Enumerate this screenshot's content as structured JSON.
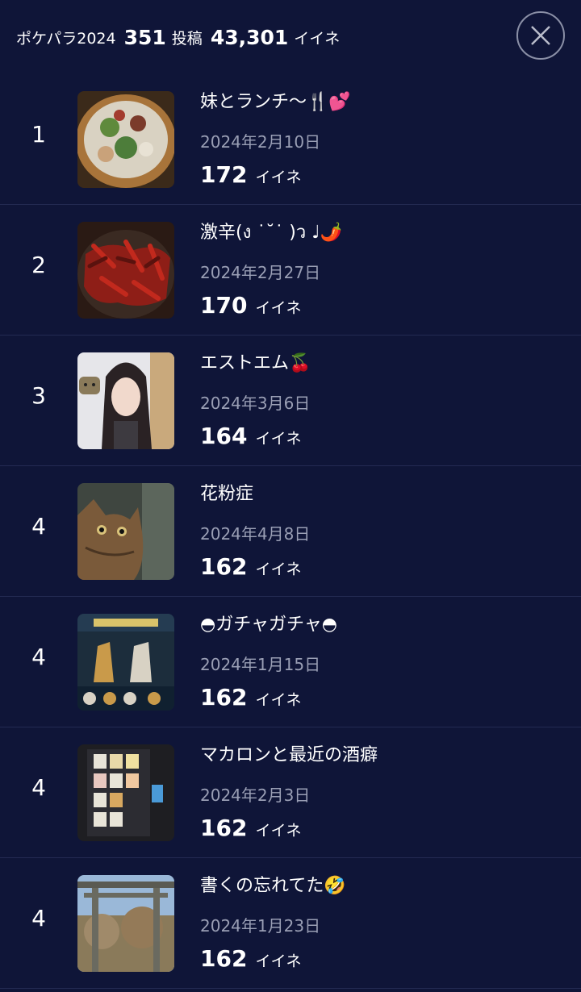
{
  "header": {
    "app_name": "ポケパラ2024",
    "post_count": "351",
    "post_unit": "投稿",
    "like_count": "43,301",
    "like_unit": "イイネ"
  },
  "posts": [
    {
      "rank": "1",
      "title": "妹とランチ〜🍴💕",
      "date": "2024年2月10日",
      "likes": "172",
      "likes_unit": "イイネ",
      "image": "salad-bowl"
    },
    {
      "rank": "2",
      "title": "激辛(ง ˙˘˙ )ว ♩🌶️",
      "date": "2024年2月27日",
      "likes": "170",
      "likes_unit": "イイネ",
      "image": "chili-dish"
    },
    {
      "rank": "3",
      "title": "エストエム🍒",
      "date": "2024年3月6日",
      "likes": "164",
      "likes_unit": "イイネ",
      "image": "portrait"
    },
    {
      "rank": "4",
      "title": "花粉症",
      "date": "2024年4月8日",
      "likes": "162",
      "likes_unit": "イイネ",
      "image": "cat"
    },
    {
      "rank": "4",
      "title": "◓ガチャガチャ◓",
      "date": "2024年1月15日",
      "likes": "162",
      "likes_unit": "イイネ",
      "image": "gacha-figures"
    },
    {
      "rank": "4",
      "title": "マカロンと最近の酒癖",
      "date": "2024年2月3日",
      "likes": "162",
      "likes_unit": "イイネ",
      "image": "vending-machine"
    },
    {
      "rank": "4",
      "title": "書くの忘れてた🤣",
      "date": "2024年1月23日",
      "likes": "162",
      "likes_unit": "イイネ",
      "image": "torii-gate"
    }
  ]
}
